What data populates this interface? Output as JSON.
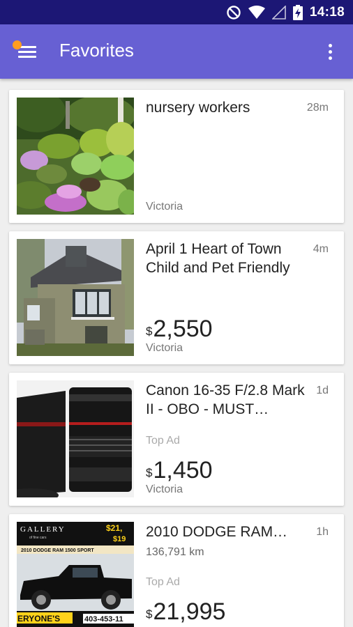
{
  "status_bar": {
    "time": "14:18",
    "icons": [
      "do-not-disturb-icon",
      "wifi-icon",
      "signal-icon",
      "battery-charging-icon"
    ]
  },
  "app_bar": {
    "title": "Favorites",
    "menu_icon": "hamburger-menu-icon",
    "more_icon": "more-vert-icon",
    "notification_dot_color": "#ff9d1f",
    "color": "#6760d3"
  },
  "listings": [
    {
      "title": "nursery workers",
      "age": "28m",
      "location": "Victoria",
      "image": "garden-photo"
    },
    {
      "title": "April 1 Heart of Town Child and Pet Friendly",
      "age": "4m",
      "currency": "$",
      "price": "2,550",
      "location": "Victoria",
      "image": "house-photo"
    },
    {
      "title": "Canon 16-35 F/2.8 Mark II - OBO - MUST…",
      "age": "1d",
      "badge": "Top Ad",
      "currency": "$",
      "price": "1,450",
      "location": "Victoria",
      "image": "camera-lens-photo"
    },
    {
      "title": "2010 DODGE RAM…",
      "age": "1h",
      "subtitle": "136,791 km",
      "badge": "Top Ad",
      "currency": "$",
      "price": "21,995",
      "image": "truck-ad-photo",
      "image_text": {
        "brand": "GALLERY",
        "tagline": "of fine cars",
        "price_top": "$21,",
        "price_sub": "$19",
        "banner": "2010 DODGE RAM 1500 SPORT",
        "slogan": "ERYONE'S",
        "phone": "403-453-11"
      }
    }
  ]
}
